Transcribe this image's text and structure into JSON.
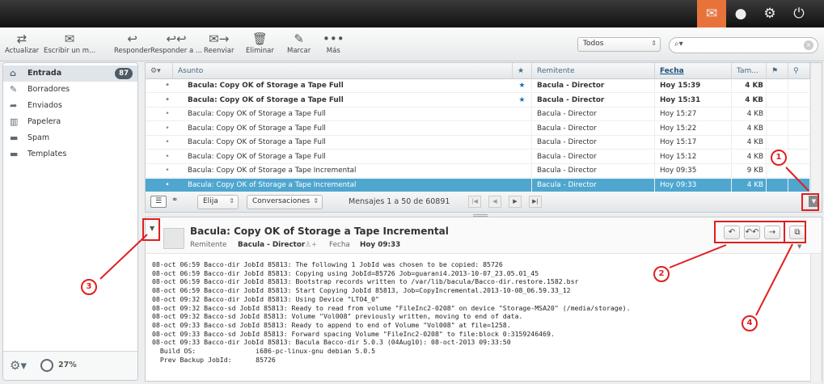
{
  "toolbar": {
    "refresh": "Actualizar",
    "compose": "Escribir un m...",
    "reply": "Responder",
    "reply_all": "Responder a ...",
    "forward": "Reenviar",
    "delete": "Eliminar",
    "mark": "Marcar",
    "more": "Más",
    "filter_value": "Todos",
    "search_placeholder": ""
  },
  "folders": [
    {
      "label": "Entrada",
      "count": "87",
      "icon": "inbox-icon"
    },
    {
      "label": "Borradores",
      "icon": "drafts-icon"
    },
    {
      "label": "Enviados",
      "icon": "sent-icon"
    },
    {
      "label": "Papelera",
      "icon": "trash-icon"
    },
    {
      "label": "Spam",
      "icon": "folder-icon"
    },
    {
      "label": "Templates",
      "icon": "folder-icon"
    }
  ],
  "quota": "27%",
  "list": {
    "columns": {
      "subject": "Asunto",
      "sender": "Remitente",
      "date": "Fecha",
      "size": "Tam..."
    },
    "rows": [
      {
        "subject": "Bacula: Copy OK of Storage a Tape Full",
        "sender": "Bacula - Director",
        "date": "Hoy 15:39",
        "size": "4 KB",
        "unread": true,
        "flagged": true
      },
      {
        "subject": "Bacula: Copy OK of Storage a Tape Full",
        "sender": "Bacula - Director",
        "date": "Hoy 15:31",
        "size": "4 KB",
        "unread": true,
        "flagged": true
      },
      {
        "subject": "Bacula: Copy OK of Storage a Tape Full",
        "sender": "Bacula - Director",
        "date": "Hoy 15:27",
        "size": "4 KB"
      },
      {
        "subject": "Bacula: Copy OK of Storage a Tape Full",
        "sender": "Bacula - Director",
        "date": "Hoy 15:22",
        "size": "4 KB"
      },
      {
        "subject": "Bacula: Copy OK of Storage a Tape Full",
        "sender": "Bacula - Director",
        "date": "Hoy 15:17",
        "size": "4 KB"
      },
      {
        "subject": "Bacula: Copy OK of Storage a Tape Full",
        "sender": "Bacula - Director",
        "date": "Hoy 15:12",
        "size": "4 KB"
      },
      {
        "subject": "Bacula: Copy OK of Storage a Tape Incremental",
        "sender": "Bacula - Director",
        "date": "Hoy 09:35",
        "size": "9 KB"
      },
      {
        "subject": "Bacula: Copy OK of Storage a Tape Incremental",
        "sender": "Bacula - Director",
        "date": "Hoy 09:33",
        "size": "4 KB",
        "selected": true
      }
    ],
    "footer": {
      "select": "Elija",
      "threads": "Conversaciones",
      "count_text": "Mensajes 1 a 50 de 60891"
    }
  },
  "preview": {
    "subject": "Bacula: Copy OK of Storage a Tape Incremental",
    "sender_label": "Remitente",
    "sender": "Bacula - Director",
    "date_label": "Fecha",
    "date": "Hoy 09:33",
    "body": "08-oct 06:59 Bacco-dir JobId 85813: The following 1 JobId was chosen to be copied: 85726\n08-oct 06:59 Bacco-dir JobId 85813: Copying using JobId=85726 Job=guarani4.2013-10-07_23.05.01_45\n08-oct 06:59 Bacco-dir JobId 85813: Bootstrap records written to /var/lib/bacula/Bacco-dir.restore.1582.bsr\n08-oct 06:59 Bacco-dir JobId 85813: Start Copying JobId 85813, Job=CopyIncremental.2013-10-08_06.59.33_12\n08-oct 09:32 Bacco-dir JobId 85813: Using Device \"LTO4_0\"\n08-oct 09:32 Bacco-sd JobId 85813: Ready to read from volume \"FileInc2-0208\" on device \"Storage-MSA20\" (/media/storage).\n08-oct 09:32 Bacco-sd JobId 85813: Volume \"Vol008\" previously written, moving to end of data.\n08-oct 09:33 Bacco-sd JobId 85813: Ready to append to end of Volume \"Vol008\" at file=1258.\n08-oct 09:33 Bacco-sd JobId 85813: Forward spacing Volume \"FileInc2-0208\" to file:block 0:3159246469.\n08-oct 09:33 Bacco-dir JobId 85813: Bacula Bacco-dir 5.0.3 (04Aug10): 08-oct-2013 09:33:50\n  Build OS:               i686-pc-linux-gnu debian 5.0.5\n  Prev Backup JobId:      85726"
  },
  "callouts": [
    "1",
    "2",
    "3",
    "4"
  ],
  "colors": {
    "accent": "#e8733a",
    "selected_row": "#4fa6cf",
    "annotation": "#e01f1f"
  }
}
